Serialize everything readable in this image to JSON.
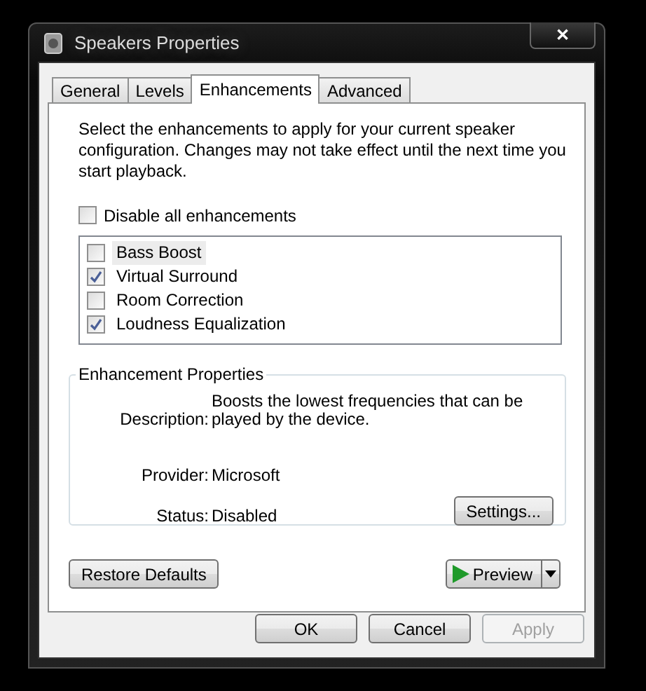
{
  "window": {
    "title": "Speakers Properties",
    "close": "✕"
  },
  "tabs": [
    {
      "label": "General",
      "selected": false
    },
    {
      "label": "Levels",
      "selected": false
    },
    {
      "label": "Enhancements",
      "selected": true
    },
    {
      "label": "Advanced",
      "selected": false
    }
  ],
  "intro": "Select the enhancements to apply for your current speaker configuration. Changes may not take effect until the next time you start playback.",
  "disable_all": {
    "label": "Disable all enhancements",
    "checked": false
  },
  "enhancements": [
    {
      "label": "Bass Boost",
      "checked": false,
      "selected": true
    },
    {
      "label": "Virtual Surround",
      "checked": true,
      "selected": false
    },
    {
      "label": "Room Correction",
      "checked": false,
      "selected": false
    },
    {
      "label": "Loudness Equalization",
      "checked": true,
      "selected": false
    }
  ],
  "properties": {
    "title": "Enhancement Properties",
    "rows": [
      {
        "label": "Description:",
        "value": "Boosts the lowest frequencies that can be played by the device."
      },
      {
        "label": "Provider:",
        "value": "Microsoft"
      },
      {
        "label": "Status:",
        "value": "Disabled"
      }
    ],
    "settings_button": "Settings..."
  },
  "restore_button": "Restore Defaults",
  "preview_button": "Preview",
  "buttons": [
    {
      "label": "OK",
      "disabled": false
    },
    {
      "label": "Cancel",
      "disabled": false
    },
    {
      "label": "Apply",
      "disabled": true
    }
  ]
}
